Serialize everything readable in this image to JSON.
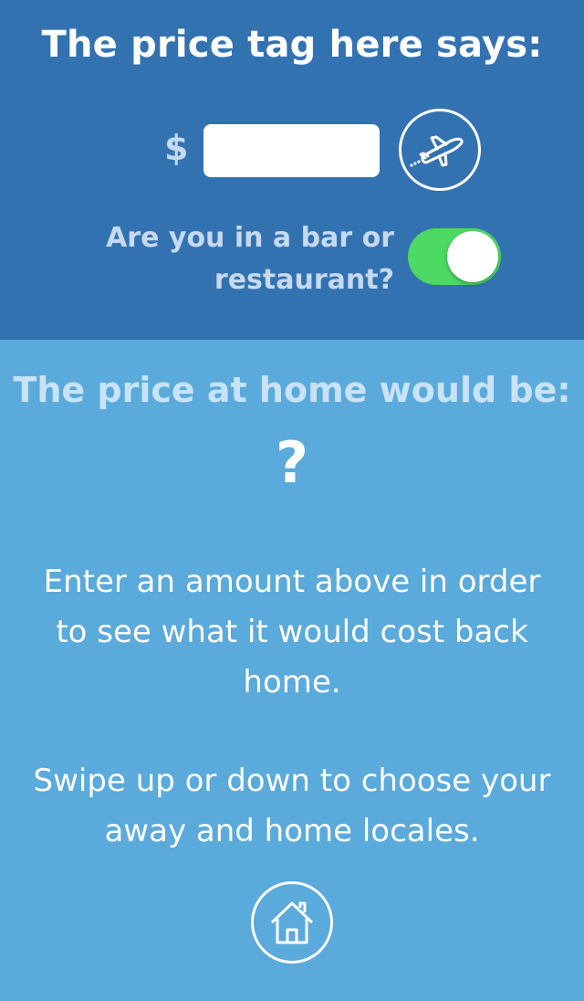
{
  "header": {
    "title": "The price tag here says:",
    "currency_symbol": "$",
    "price_input": {
      "value": "",
      "placeholder": ""
    },
    "away_locale_icon": "airplane-icon",
    "bar_question": "Are you in a bar or restaurant?",
    "bar_toggle_on": true,
    "toggle_color": "#4CD964"
  },
  "main": {
    "title": "The price at home would be:",
    "result": "?",
    "instruction_text": "Enter an amount above in order to see what it would cost back home.",
    "swipe_text": "Swipe up or down to choose your away and home locales.",
    "home_locale_icon": "home-icon"
  },
  "colors": {
    "top_background": "#3372B1",
    "bottom_background": "#5AAADB"
  }
}
